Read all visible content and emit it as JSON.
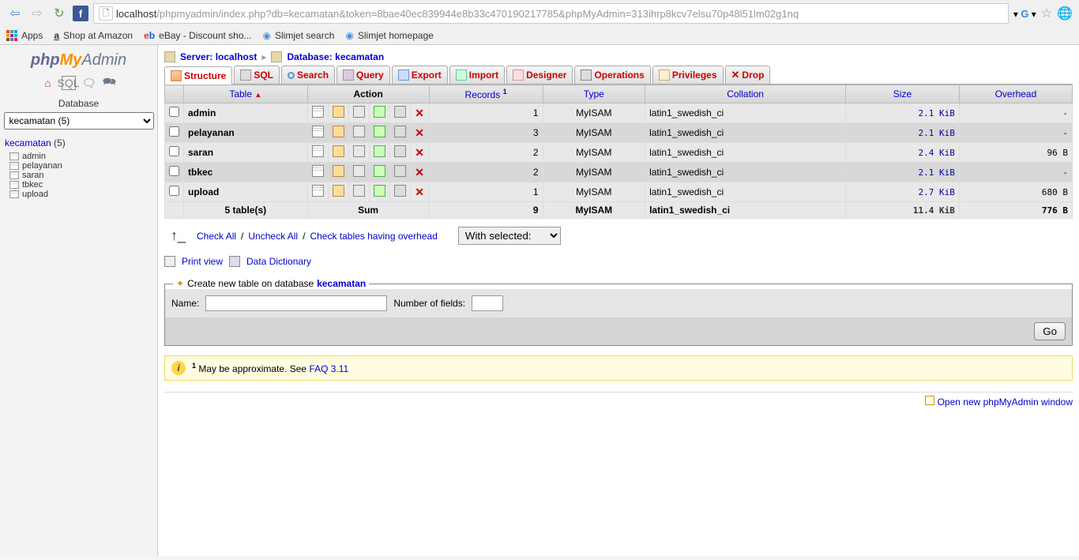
{
  "browser": {
    "url_host": "localhost",
    "url_path": "/phpmyadmin/index.php?db=kecamatan&token=8bae40ec839944e8b33c470190217785&phpMyAdmin=313ihrp8kcv7elsu70p48l51lm02g1nq",
    "bookmarks": {
      "apps": "Apps",
      "amazon": "Shop at Amazon",
      "ebay": "eBay - Discount sho...",
      "slimjet_search": "Slimjet search",
      "slimjet_home": "Slimjet homepage"
    }
  },
  "sidebar": {
    "db_label": "Database",
    "db_selected": "kecamatan (5)",
    "tree_db": "kecamatan",
    "tree_count": "(5)",
    "tables": [
      "admin",
      "pelayanan",
      "saran",
      "tbkec",
      "upload"
    ]
  },
  "breadcrumb": {
    "server_label": "Server:",
    "server_value": "localhost",
    "db_label": "Database:",
    "db_value": "kecamatan"
  },
  "tabs": {
    "structure": "Structure",
    "sql": "SQL",
    "search": "Search",
    "query": "Query",
    "export": "Export",
    "import": "Import",
    "designer": "Designer",
    "operations": "Operations",
    "privileges": "Privileges",
    "drop": "Drop"
  },
  "table_headers": {
    "table": "Table",
    "action": "Action",
    "records": "Records",
    "type": "Type",
    "collation": "Collation",
    "size": "Size",
    "overhead": "Overhead"
  },
  "rows": [
    {
      "name": "admin",
      "records": "1",
      "type": "MyISAM",
      "collation": "latin1_swedish_ci",
      "size": "2.1 KiB",
      "overhead": "-"
    },
    {
      "name": "pelayanan",
      "records": "3",
      "type": "MyISAM",
      "collation": "latin1_swedish_ci",
      "size": "2.1 KiB",
      "overhead": "-"
    },
    {
      "name": "saran",
      "records": "2",
      "type": "MyISAM",
      "collation": "latin1_swedish_ci",
      "size": "2.4 KiB",
      "overhead": "96 B"
    },
    {
      "name": "tbkec",
      "records": "2",
      "type": "MyISAM",
      "collation": "latin1_swedish_ci",
      "size": "2.1 KiB",
      "overhead": "-"
    },
    {
      "name": "upload",
      "records": "1",
      "type": "MyISAM",
      "collation": "latin1_swedish_ci",
      "size": "2.7 KiB",
      "overhead": "680 B"
    }
  ],
  "sum": {
    "label": "5 table(s)",
    "sum_label": "Sum",
    "records": "9",
    "type": "MyISAM",
    "collation": "latin1_swedish_ci",
    "size": "11.4 KiB",
    "overhead": "776 B"
  },
  "checkrow": {
    "check_all": "Check All",
    "uncheck_all": "Uncheck All",
    "check_overhead": "Check tables having overhead",
    "with_selected": "With selected:"
  },
  "links": {
    "print_view": "Print view",
    "data_dict": "Data Dictionary"
  },
  "newtbl": {
    "legend_text": "Create new table on database",
    "legend_db": "kecamatan",
    "name_label": "Name:",
    "fields_label": "Number of fields:",
    "go": "Go"
  },
  "notice": {
    "sup": "1",
    "text": " May be approximate. See ",
    "faq": "FAQ 3.11"
  },
  "footer": {
    "open_new": "Open new phpMyAdmin window"
  }
}
